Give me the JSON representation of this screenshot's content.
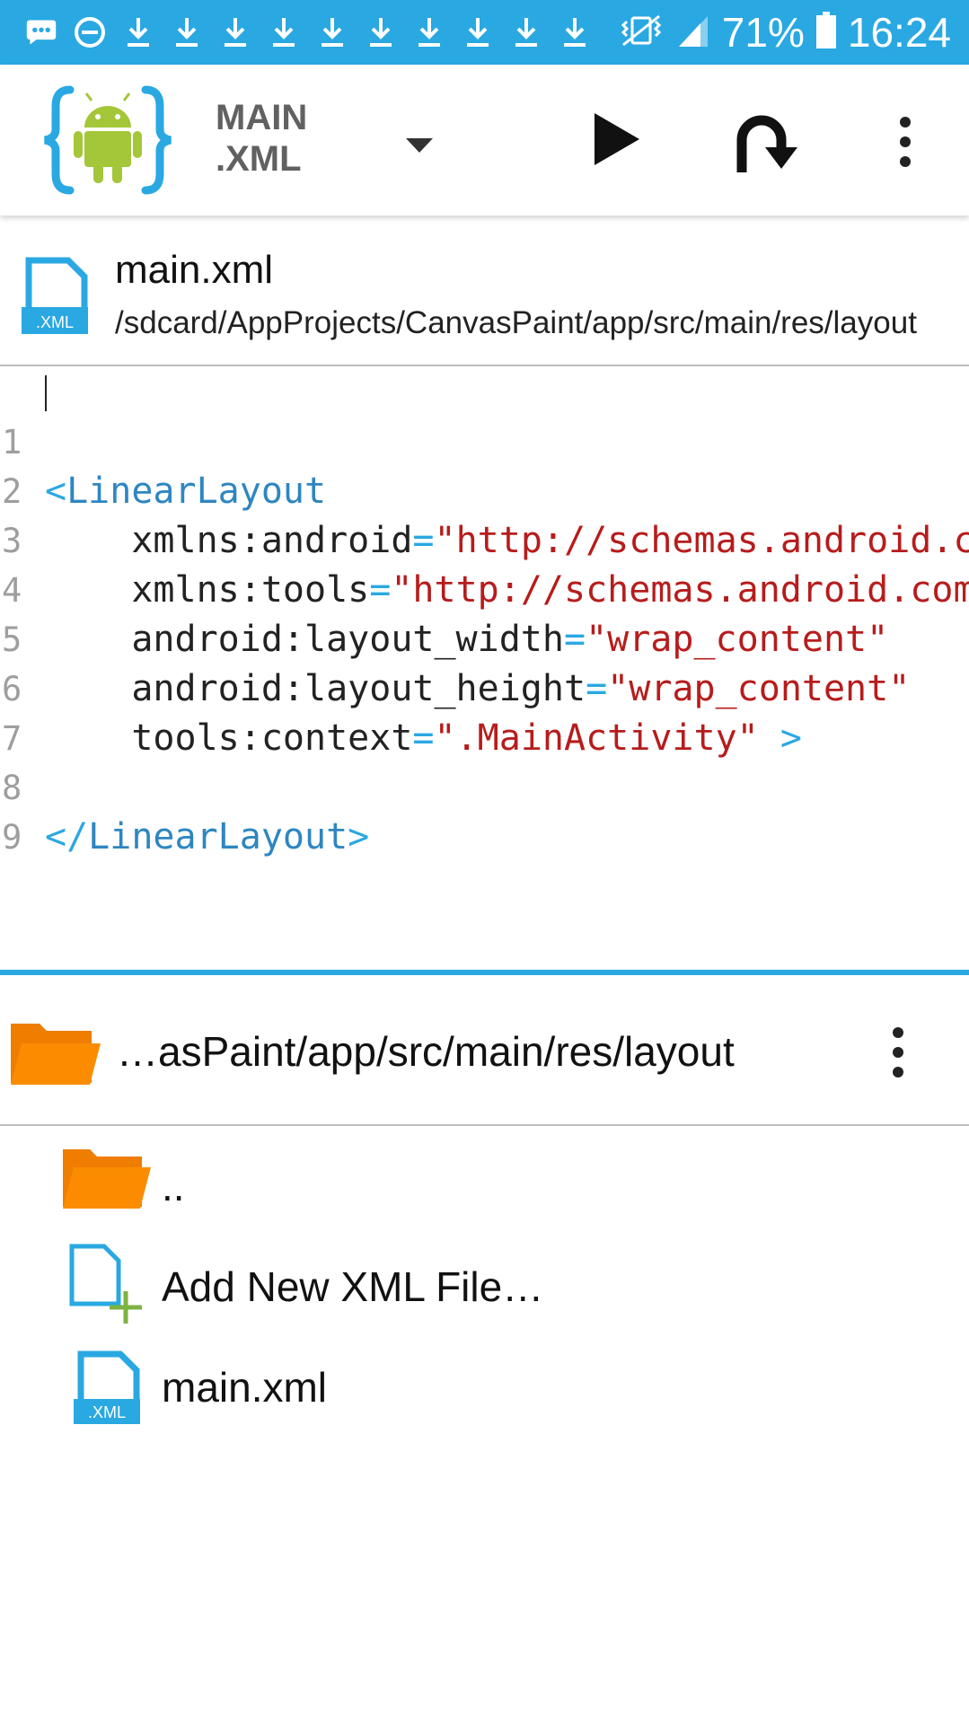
{
  "status_bar": {
    "battery": "71%",
    "time": "16:24",
    "left_icons": [
      "chat-icon",
      "do-not-disturb-icon",
      "download-icon",
      "download-icon",
      "download-icon",
      "download-icon",
      "download-icon",
      "download-icon",
      "download-icon",
      "download-icon",
      "download-icon",
      "download-icon"
    ],
    "right_icons": [
      "vibrate-icon",
      "signal-icon",
      "battery-icon"
    ]
  },
  "app_bar": {
    "title_line1": "MAIN",
    "title_line2": ".XML",
    "actions": [
      "play-icon",
      "redo-icon",
      "more-vert-icon"
    ]
  },
  "file_header": {
    "name": "main.xml",
    "path": "/sdcard/AppProjects/CanvasPaint/app/src/main/res/layout",
    "icon_label": ".XML"
  },
  "editor": {
    "line_numbers": [
      "1",
      "2",
      "3",
      "4",
      "5",
      "6",
      "7",
      "8",
      "9"
    ],
    "lines": [
      {
        "open": "<",
        "tag": "LinearLayout"
      },
      {
        "attr": "xmlns:android",
        "eq": "=",
        "value": "\"http://schemas.android.com/apk/res/android\""
      },
      {
        "attr": "xmlns:tools",
        "eq": "=",
        "value": "\"http://schemas.android.com/tools\""
      },
      {
        "attr": "android:layout_width",
        "eq": "=",
        "value": "\"wrap_content\""
      },
      {
        "attr": "android:layout_height",
        "eq": "=",
        "value": "\"wrap_content\""
      },
      {
        "attr": "tools:context",
        "eq": "=",
        "value": "\".MainActivity\"",
        "close": " >"
      },
      {},
      {
        "open": "</",
        "tag": "LinearLayout",
        "close": ">"
      },
      {}
    ]
  },
  "browser": {
    "path": "…asPaint/app/src/main/res/layout",
    "items": [
      {
        "label": "..",
        "icon": "folder-icon"
      },
      {
        "label": "Add New XML File…",
        "icon": "new-file-icon"
      },
      {
        "label": "main.xml",
        "icon": "xml-file-icon",
        "icon_label": ".XML"
      }
    ]
  },
  "colors": {
    "accent": "#2aa8e2",
    "folder": "#fb8c00",
    "tag": "#2e86c1",
    "string": "#b71c1c",
    "plus": "#7cb342"
  }
}
